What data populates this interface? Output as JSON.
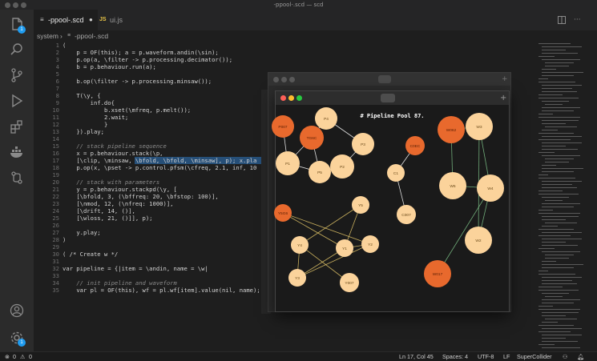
{
  "window": {
    "title": "-ppool-.scd — scd"
  },
  "tabs": [
    {
      "label": "-ppool-.scd",
      "modified": true,
      "active": true
    },
    {
      "label": "ui.js",
      "active": false
    }
  ],
  "breadcrumb": {
    "root": "system",
    "file": "-ppool-.scd"
  },
  "editor": {
    "lines": [
      {
        "n": "1",
        "text": "(",
        "indent": 0
      },
      {
        "n": "2",
        "text": "p = OF(this); a = p.waveform.andin(\\sin);",
        "indent": 1
      },
      {
        "n": "3",
        "text": "p.op(a, \\filter -> p.processing.decimator());",
        "indent": 1
      },
      {
        "n": "4",
        "text": "b = p.behaviour.run(a);",
        "indent": 1
      },
      {
        "n": "5",
        "text": "",
        "indent": 0
      },
      {
        "n": "6",
        "text": "b.op(\\filter -> p.processing.minsaw());",
        "indent": 1
      },
      {
        "n": "7",
        "text": "",
        "indent": 0
      },
      {
        "n": "8",
        "text": "T(\\y, {",
        "indent": 1
      },
      {
        "n": "9",
        "text": "inf.do{",
        "indent": 2
      },
      {
        "n": "10",
        "text": "b.xset(\\mfreq, p.melt());",
        "indent": 3
      },
      {
        "n": "11",
        "text": "2.wait;",
        "indent": 3
      },
      {
        "n": "12",
        "text": "}",
        "indent": 3
      },
      {
        "n": "13",
        "text": "}).play;",
        "indent": 1
      },
      {
        "n": "14",
        "text": "",
        "indent": 0
      },
      {
        "n": "15",
        "text": "// stack pipeline sequence",
        "indent": 1,
        "comment": true
      },
      {
        "n": "16",
        "text": "x = p.behaviour.stack(\\p,",
        "indent": 1
      },
      {
        "n": "17",
        "text": "[\\clip, \\minsaw, \\bfold, \\bfold, \\minsaw], p); x.pla",
        "indent": 1,
        "selected": true
      },
      {
        "n": "18",
        "text": "p.op(x, \\pset -> p.control.pfsm(\\cfreq, 2.1, inf, 10",
        "indent": 1
      },
      {
        "n": "19",
        "text": "",
        "indent": 0
      },
      {
        "n": "20",
        "text": "// stack with parameters",
        "indent": 1,
        "comment": true
      },
      {
        "n": "21",
        "text": "y = p.behaviour.stackpd(\\y, [",
        "indent": 1
      },
      {
        "n": "22",
        "text": "[\\bfold, 3, (\\bffreq: 20, \\bfstop: 100)],",
        "indent": 1
      },
      {
        "n": "23",
        "text": "[\\nmod, 12, (\\nfreq: 1000)],",
        "indent": 1
      },
      {
        "n": "24",
        "text": "[\\drift, 14, ()],",
        "indent": 1
      },
      {
        "n": "25",
        "text": "[\\wloss, 21, ()]], p);",
        "indent": 1
      },
      {
        "n": "26",
        "text": "",
        "indent": 0
      },
      {
        "n": "27",
        "text": "y.play;",
        "indent": 1
      },
      {
        "n": "28",
        "text": ")",
        "indent": 0
      },
      {
        "n": "29",
        "text": "",
        "indent": 0
      },
      {
        "n": "30",
        "text": "( /* Create w */",
        "indent": 0
      },
      {
        "n": "31",
        "text": "",
        "indent": 0
      },
      {
        "n": "32",
        "text": "var pipeline = {|item = \\andin, name = \\w|",
        "indent": 0
      },
      {
        "n": "33",
        "text": "",
        "indent": 0
      },
      {
        "n": "34",
        "text": "// init pipeline and waveform",
        "indent": 1,
        "comment": true
      },
      {
        "n": "35",
        "text": "var pl = OF(this), wf = pl.wf[item].value(nil, name);",
        "indent": 1
      }
    ]
  },
  "activity_icons": [
    "files-icon",
    "search-icon",
    "source-control-icon",
    "run-debug-icon",
    "extensions-icon",
    "docker-icon",
    "remote-icon",
    "account-icon",
    "settings-icon"
  ],
  "activity_badges": {
    "files": "1",
    "settings": "1"
  },
  "status": {
    "errors": "0",
    "warnings": "0",
    "position": "Ln 17, Col 45",
    "spaces": "Spaces: 4",
    "encoding": "UTF-8",
    "eol": "LF",
    "language": "SuperCollider"
  },
  "pool_window": {
    "title": "# Pipeline Pool 87.",
    "colors": {
      "dark": "#e8692d",
      "light": "#fbd39b",
      "edge_light": "#ffffff",
      "edge_green": "#7fc48a",
      "edge_yellow": "#e6c96a"
    },
    "nodes": [
      {
        "id": "P007",
        "tone": "dark"
      },
      {
        "id": "TG6C",
        "tone": "dark"
      },
      {
        "id": "P4",
        "tone": "light"
      },
      {
        "id": "P1",
        "tone": "light"
      },
      {
        "id": "P5",
        "tone": "light"
      },
      {
        "id": "P2",
        "tone": "light"
      },
      {
        "id": "P3",
        "tone": "light"
      },
      {
        "id": "C0EC",
        "tone": "dark"
      },
      {
        "id": "C1",
        "tone": "light"
      },
      {
        "id": "C007",
        "tone": "light"
      },
      {
        "id": "W062",
        "tone": "dark"
      },
      {
        "id": "W3",
        "tone": "light"
      },
      {
        "id": "W5",
        "tone": "light"
      },
      {
        "id": "W4",
        "tone": "light"
      },
      {
        "id": "W2",
        "tone": "light"
      },
      {
        "id": "W017",
        "tone": "dark"
      },
      {
        "id": "Y5G6",
        "tone": "dark"
      },
      {
        "id": "Y5",
        "tone": "light"
      },
      {
        "id": "Y4",
        "tone": "light"
      },
      {
        "id": "Y1",
        "tone": "light"
      },
      {
        "id": "Y2",
        "tone": "light"
      },
      {
        "id": "Y3",
        "tone": "light"
      },
      {
        "id": "Y007",
        "tone": "light"
      }
    ],
    "edges": [
      [
        "P007",
        "P1",
        "light"
      ],
      [
        "TG6C",
        "P4",
        "light"
      ],
      [
        "TG6C",
        "P5",
        "light"
      ],
      [
        "P4",
        "P3",
        "light"
      ],
      [
        "P1",
        "P5",
        "light"
      ],
      [
        "P5",
        "P2",
        "light"
      ],
      [
        "P2",
        "P3",
        "light"
      ],
      [
        "TG6C",
        "P1",
        "light"
      ],
      [
        "C0EC",
        "C1",
        "light"
      ],
      [
        "C1",
        "C007",
        "light"
      ],
      [
        "W062",
        "W3",
        "green"
      ],
      [
        "W062",
        "W5",
        "green"
      ],
      [
        "W3",
        "W4",
        "green"
      ],
      [
        "W5",
        "W4",
        "green"
      ],
      [
        "W4",
        "W2",
        "green"
      ],
      [
        "W3",
        "W2",
        "green"
      ],
      [
        "W4",
        "W017",
        "green"
      ],
      [
        "Y5G6",
        "Y1",
        "yellow"
      ],
      [
        "Y5G6",
        "Y2",
        "yellow"
      ],
      [
        "Y5",
        "Y4",
        "yellow"
      ],
      [
        "Y5",
        "Y1",
        "yellow"
      ],
      [
        "Y4",
        "Y007",
        "yellow"
      ],
      [
        "Y1",
        "Y2",
        "yellow"
      ],
      [
        "Y1",
        "Y3",
        "yellow"
      ],
      [
        "Y3",
        "Y2",
        "yellow"
      ],
      [
        "Y4",
        "Y3",
        "yellow"
      ]
    ]
  }
}
